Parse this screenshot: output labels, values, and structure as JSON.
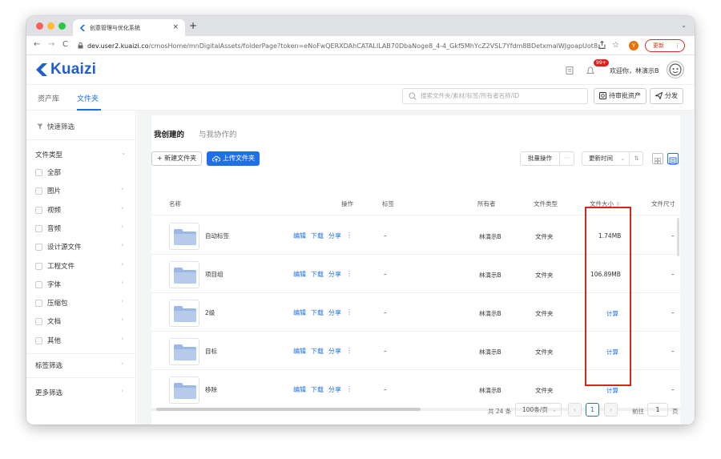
{
  "browser": {
    "tab_title": "创意管理与优化系统",
    "tab_close": "×",
    "new_tab": "+",
    "tab_dropdown": "⌄",
    "nav": {
      "back": "←",
      "forward": "→",
      "reload": "C"
    },
    "url_host": "dev.user2.kuaizi.co",
    "url_path": "/cmosHome/mnDigitalAssets/folderPage?token=eNoFwQERXDAhCATALILAB70DbaNoge8_4-4_Gkf5MhYcZ2VSL7Yfdm8BDetxmalWJgoapUot8...",
    "profile_initial": "Y",
    "update_label": "更新",
    "update_more": "⋮"
  },
  "header": {
    "logo_text": "Kuaizi",
    "notification_badge": "99+",
    "welcome_text": "欢迎你，林演示B"
  },
  "modules": {
    "tabs": [
      {
        "label": "资产库"
      },
      {
        "label": "文件夹"
      }
    ],
    "active_index": 1,
    "search_placeholder": "搜索文件夹/素材/标签/所有者名称/ID",
    "review_label": "待审批资产",
    "share_label": "分发"
  },
  "sidebar": {
    "quick_filter": "快速筛选",
    "file_type_label": "文件类型",
    "types": [
      {
        "label": "全部",
        "has_arrow": false
      },
      {
        "label": "图片",
        "has_arrow": true
      },
      {
        "label": "视频",
        "has_arrow": true
      },
      {
        "label": "音频",
        "has_arrow": true
      },
      {
        "label": "设计源文件",
        "has_arrow": true
      },
      {
        "label": "工程文件",
        "has_arrow": true
      },
      {
        "label": "字体",
        "has_arrow": true
      },
      {
        "label": "压缩包",
        "has_arrow": true
      },
      {
        "label": "文档",
        "has_arrow": true
      },
      {
        "label": "其他",
        "has_arrow": true
      }
    ],
    "tag_filter": "标签筛选",
    "more_filter": "更多筛选",
    "chevron_down": "⌄",
    "chevron_right": "›"
  },
  "main": {
    "subtabs": [
      {
        "label": "我创建的"
      },
      {
        "label": "与我协作的"
      }
    ],
    "new_folder_label": "+ 新建文件夹",
    "upload_label": "上传文件夹",
    "batch_label": "批量操作",
    "batch_more": "···",
    "sort_label": "更新时间",
    "sort_dropdown": "⌄",
    "sort_order": "⇅",
    "columns": {
      "name": "名称",
      "actions": "操作",
      "tags": "标签",
      "owner": "所有者",
      "type": "文件类型",
      "size": "文件大小",
      "sort_icon": "⇳",
      "dims": "文件尺寸"
    },
    "rows": [
      {
        "name": "自动标签",
        "edit": "编辑",
        "download": "下载",
        "share": "分享",
        "more": "⋮",
        "tag": "–",
        "owner": "林演示B",
        "type": "文件夹",
        "size": "1.74MB",
        "dims": "–"
      },
      {
        "name": "项目组",
        "edit": "编辑",
        "download": "下载",
        "share": "分享",
        "more": "⋮",
        "tag": "–",
        "owner": "林演示B",
        "type": "文件夹",
        "size": "106.89MB",
        "dims": "–"
      },
      {
        "name": "2级",
        "edit": "编辑",
        "download": "下载",
        "share": "分享",
        "more": "⋮",
        "tag": "–",
        "owner": "林演示B",
        "type": "文件夹",
        "size": "计算",
        "dims": "–"
      },
      {
        "name": "目标",
        "edit": "编辑",
        "download": "下载",
        "share": "分享",
        "more": "⋮",
        "tag": "–",
        "owner": "林演示B",
        "type": "文件夹",
        "size": "计算",
        "dims": "–"
      },
      {
        "name": "移除",
        "edit": "编辑",
        "download": "下载",
        "share": "分享",
        "more": "⋮",
        "tag": "–",
        "owner": "林演示B",
        "type": "文件夹",
        "size": "计算",
        "dims": "–"
      }
    ],
    "pagination": {
      "total": "共 24 条",
      "page_size": "100条/页",
      "dropdown": "⌄",
      "prev": "‹",
      "current": "1",
      "next": "›",
      "goto_label": "前往",
      "goto_value": "1",
      "page_suffix": "页"
    }
  },
  "colors": {
    "accent": "#1f6feb",
    "brand": "#1f5fcf",
    "highlight": "#d8261c"
  }
}
